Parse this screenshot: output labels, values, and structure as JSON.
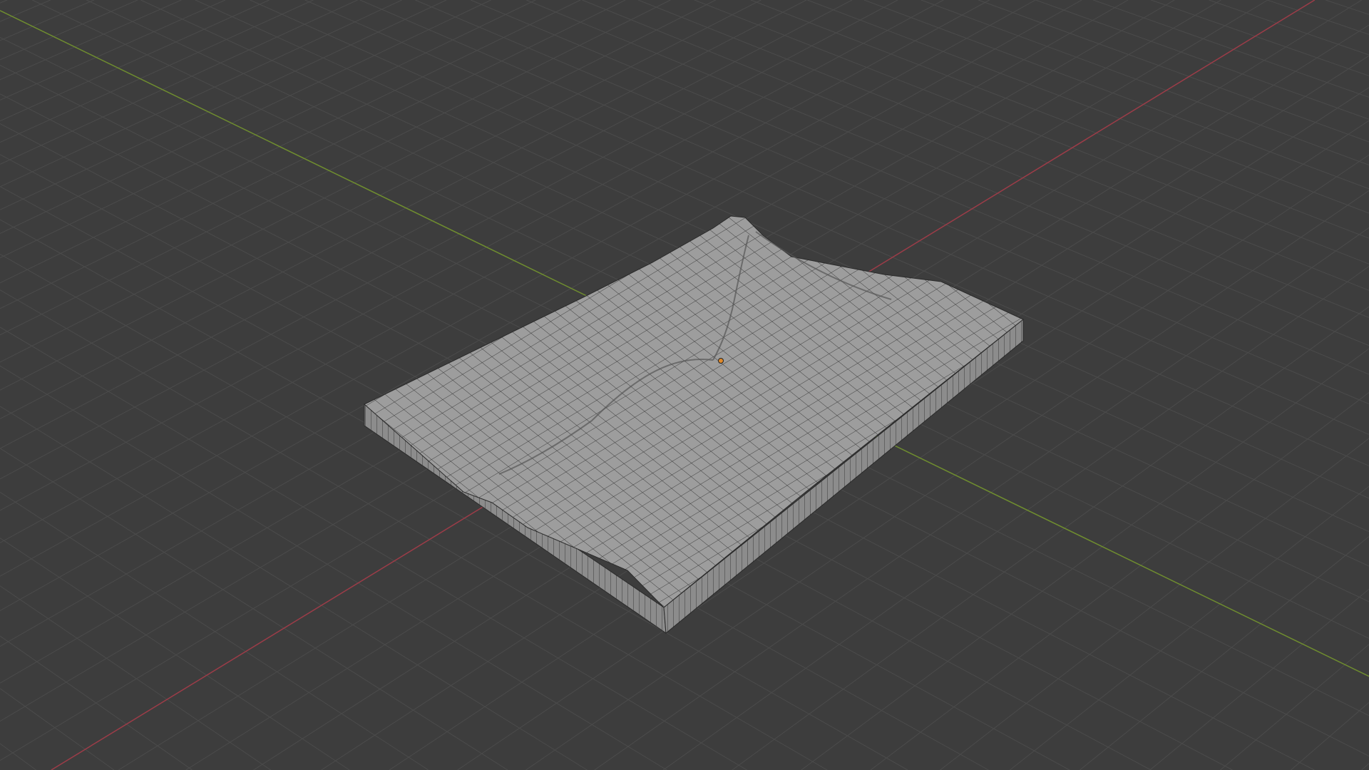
{
  "viewport": {
    "background_color": "#3d3d3d",
    "grid_color": "#4b4b4b",
    "x_axis_color": "#9c3c48",
    "y_axis_color": "#6f8d2f",
    "mesh_top_color": "#9d9d9d",
    "mesh_side_color": "#8c8c8c",
    "wire_color": "#2a2a2a",
    "origin_color": "#e0892a",
    "object_icon": "terrain-mesh",
    "origin_icon": "origin-dot-icon"
  }
}
